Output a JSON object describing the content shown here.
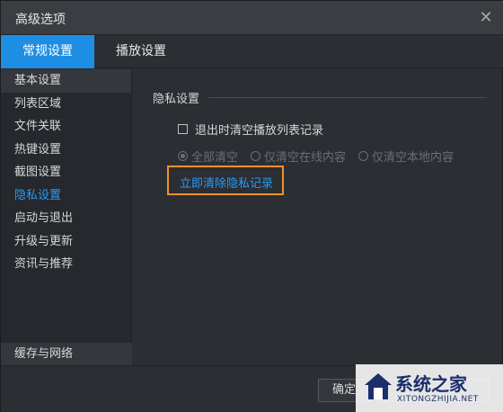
{
  "window": {
    "title": "高级选项",
    "close_icon": "close-icon"
  },
  "tabs": [
    {
      "label": "常规设置",
      "active": true
    },
    {
      "label": "播放设置",
      "active": false
    }
  ],
  "sidebar": {
    "items": [
      {
        "label": "基本设置"
      },
      {
        "label": "列表区域"
      },
      {
        "label": "文件关联"
      },
      {
        "label": "热键设置"
      },
      {
        "label": "截图设置"
      },
      {
        "label": "隐私设置",
        "active": true
      },
      {
        "label": "启动与退出"
      },
      {
        "label": "升级与更新"
      },
      {
        "label": "资讯与推荐"
      }
    ],
    "bottom_item": "缓存与网络"
  },
  "privacy": {
    "section_title": "隐私设置",
    "clear_on_exit_label": "退出时清空播放列表记录",
    "clear_on_exit_checked": false,
    "radio_options": [
      {
        "label": "全部清空",
        "selected": true
      },
      {
        "label": "仅清空在线内容",
        "selected": false
      },
      {
        "label": "仅清空本地内容",
        "selected": false
      }
    ],
    "clear_now_link": "立即清除隐私记录"
  },
  "footer": {
    "ok_label": "确定",
    "cancel_label": "",
    "apply_label": ""
  },
  "watermark": {
    "brand": "系统之家",
    "url": "XITONGZHIJIA.NET"
  },
  "colors": {
    "accent": "#1e8ee4",
    "link": "#2b9af3",
    "highlight_box": "#f0922b",
    "background": "#2b2e33"
  }
}
